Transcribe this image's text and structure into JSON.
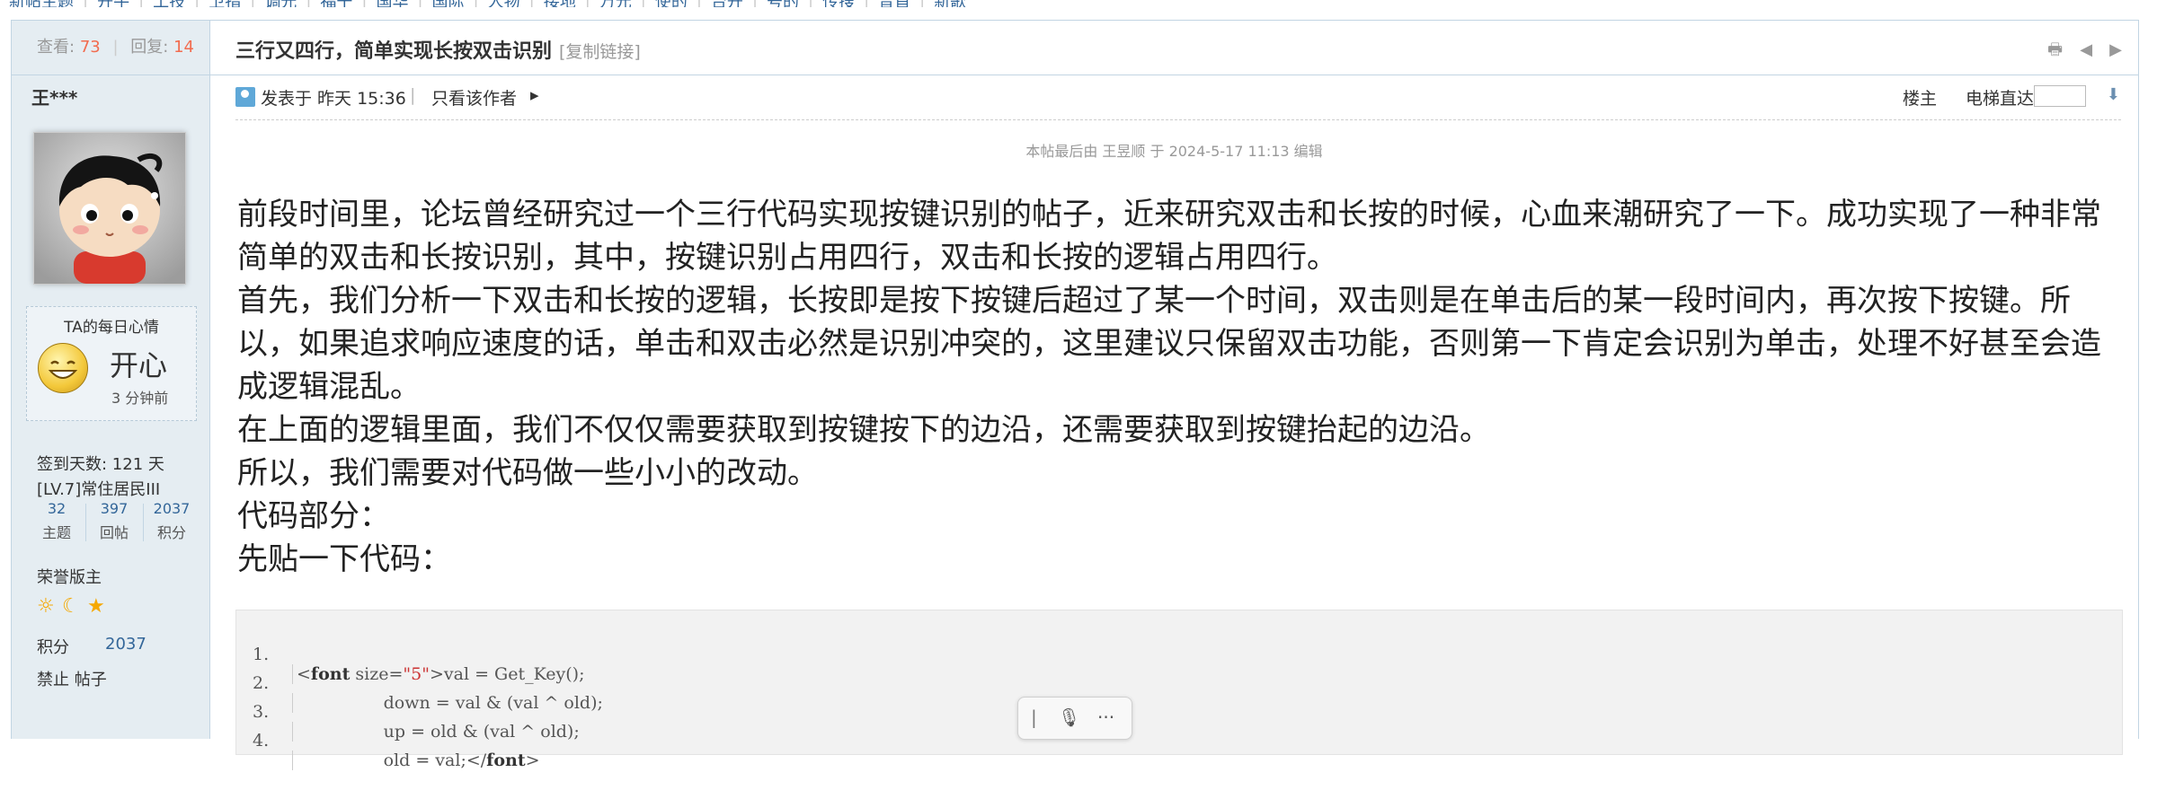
{
  "topnav": [
    "新帖主题",
    "开牛",
    "工技",
    "卫指",
    "调光",
    "福干",
    "国华",
    "国际",
    "人物",
    "接地",
    "万元",
    "使的",
    "台开",
    "号的",
    "传搜",
    "音首",
    "新歌"
  ],
  "stats": {
    "views_label": "查看:",
    "views": "73",
    "replies_label": "回复:",
    "replies": "14"
  },
  "user": {
    "name": "王***",
    "mood_title": "TA的每日心情",
    "mood": "开心",
    "mood_time": "3 分钟前",
    "signin": "签到天数: 121 天",
    "level": "[LV.7]常住居民III",
    "counts": [
      {
        "value": "32",
        "label": "主题"
      },
      {
        "value": "397",
        "label": "回帖"
      },
      {
        "value": "2037",
        "label": "积分"
      }
    ],
    "honor": "荣誉版主",
    "points_label": "积分",
    "points": "2037",
    "ban": "禁止 帖子"
  },
  "thread": {
    "title": "三行又四行，简单实现长按双击识别",
    "copy_link": "[复制链接]",
    "posted": "发表于 昨天 15:36",
    "sep": "|",
    "only_author": "只看该作者",
    "owner": "楼主",
    "elevator": "电梯直达",
    "edited": "本帖最后由 王昱顺 于 2024-5-17 11:13 编辑"
  },
  "content": [
    "前段时间里，论坛曾经研究过一个三行代码实现按键识别的帖子，近来研究双击和长按的时候，心血来潮研究了一下。成功实现了一种非常简单的双击和长按识别，其中，按键识别占用四行，双击和长按的逻辑占用四行。",
    "首先，我们分析一下双击和长按的逻辑，长按即是按下按键后超过了某一个时间，双击则是在单击后的某一段时间内，再次按下按键。所以，如果追求响应速度的话，单击和双击必然是识别冲突的，这里建议只保留双击功能，否则第一下肯定会识别为单击，处理不好甚至会造成逻辑混乱。",
    "在上面的逻辑里面，我们不仅仅需要获取到按键按下的边沿，还需要获取到按键抬起的边沿。",
    "所以，我们需要对代码做一些小小的改动。",
    "代码部分：",
    "先贴一下代码："
  ],
  "code": {
    "line_numbers": [
      "1.",
      "2.",
      "3.",
      "4."
    ],
    "line1_open": "<",
    "line1_tag": "font",
    "line1_attr": " size=",
    "line1_val": "\"5\"",
    "line1_rest": ">val = Get_Key();",
    "line2": "                down = val & (val ^ old);",
    "line3": "                up = old & (val ^ old);",
    "line4_text": "                old = val;</",
    "line4_tag": "font",
    "line4_close": ">"
  },
  "colors": {
    "accent": "#369",
    "highlight": "#f26c4f",
    "border": "#c2d5e3",
    "side_bg": "#e5edf2"
  }
}
